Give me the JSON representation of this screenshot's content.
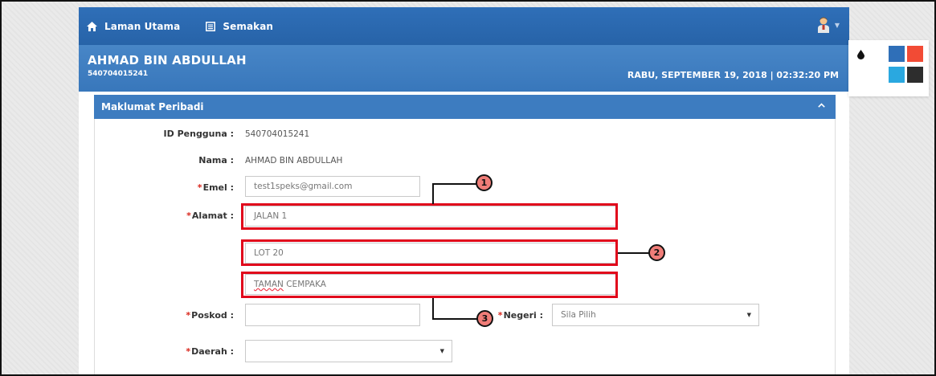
{
  "nav": {
    "items": [
      {
        "label": "Laman Utama",
        "icon": "home-icon"
      },
      {
        "label": "Semakan",
        "icon": "document-icon"
      }
    ],
    "user_icon": "user-avatar-icon"
  },
  "header": {
    "name": "AHMAD BIN ABDULLAH",
    "id": "540704015241",
    "datetime": "RABU, SEPTEMBER 19, 2018 | 02:32:20 PM"
  },
  "panel": {
    "title": "Maklumat Peribadi"
  },
  "form": {
    "id_label": "ID Pengguna :",
    "id_value": "540704015241",
    "name_label": "Nama :",
    "name_value": "AHMAD BIN ABDULLAH",
    "email_label": "Emel :",
    "email_value": "test1speks@gmail.com",
    "address_label": "Alamat :",
    "address_line1": "JALAN 1",
    "address_line2": "LOT 20",
    "address_line3_a": "TAMAN",
    "address_line3_b": " CEMPAKA",
    "poskod_label": "Poskod :",
    "poskod_value": "",
    "negeri_label": "Negeri :",
    "negeri_value": "Sila Pilih",
    "daerah_label": "Daerah :",
    "daerah_value": ""
  },
  "annotations": [
    "1",
    "2",
    "3"
  ],
  "theme": {
    "icon": "droplet-icon",
    "colors": [
      "#2f6fb8",
      "#f24b35",
      "#2aa8e0",
      "#2d2d2d"
    ]
  }
}
